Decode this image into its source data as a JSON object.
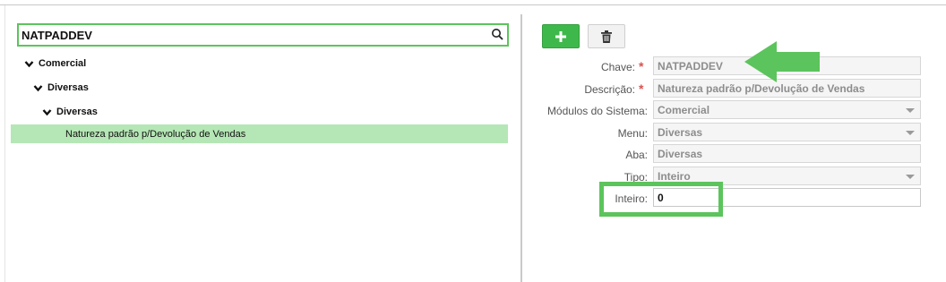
{
  "search": {
    "value": "NATPADDEV"
  },
  "tree": {
    "nodes": [
      {
        "label": "Comercial"
      },
      {
        "label": "Diversas"
      },
      {
        "label": "Diversas"
      }
    ],
    "selected": "Natureza padrão p/Devolução de Vendas"
  },
  "toolbar": {
    "add_label": "+"
  },
  "form": {
    "chave": {
      "label": "Chave:",
      "value": "NATPADDEV"
    },
    "descricao": {
      "label": "Descrição:",
      "value": "Natureza padrão p/Devolução de Vendas"
    },
    "modulos": {
      "label": "Módulos do Sistema:",
      "value": "Comercial"
    },
    "menu": {
      "label": "Menu:",
      "value": "Diversas"
    },
    "aba": {
      "label": "Aba:",
      "value": "Diversas"
    },
    "tipo": {
      "label": "Tipo:",
      "value": "Inteiro"
    },
    "inteiro": {
      "label": "Inteiro:",
      "value": "0"
    }
  },
  "colors": {
    "accent_green": "#5cc45c",
    "button_green": "#3fb84b",
    "selection": "#b5e6b5",
    "required": "#d9534f"
  }
}
